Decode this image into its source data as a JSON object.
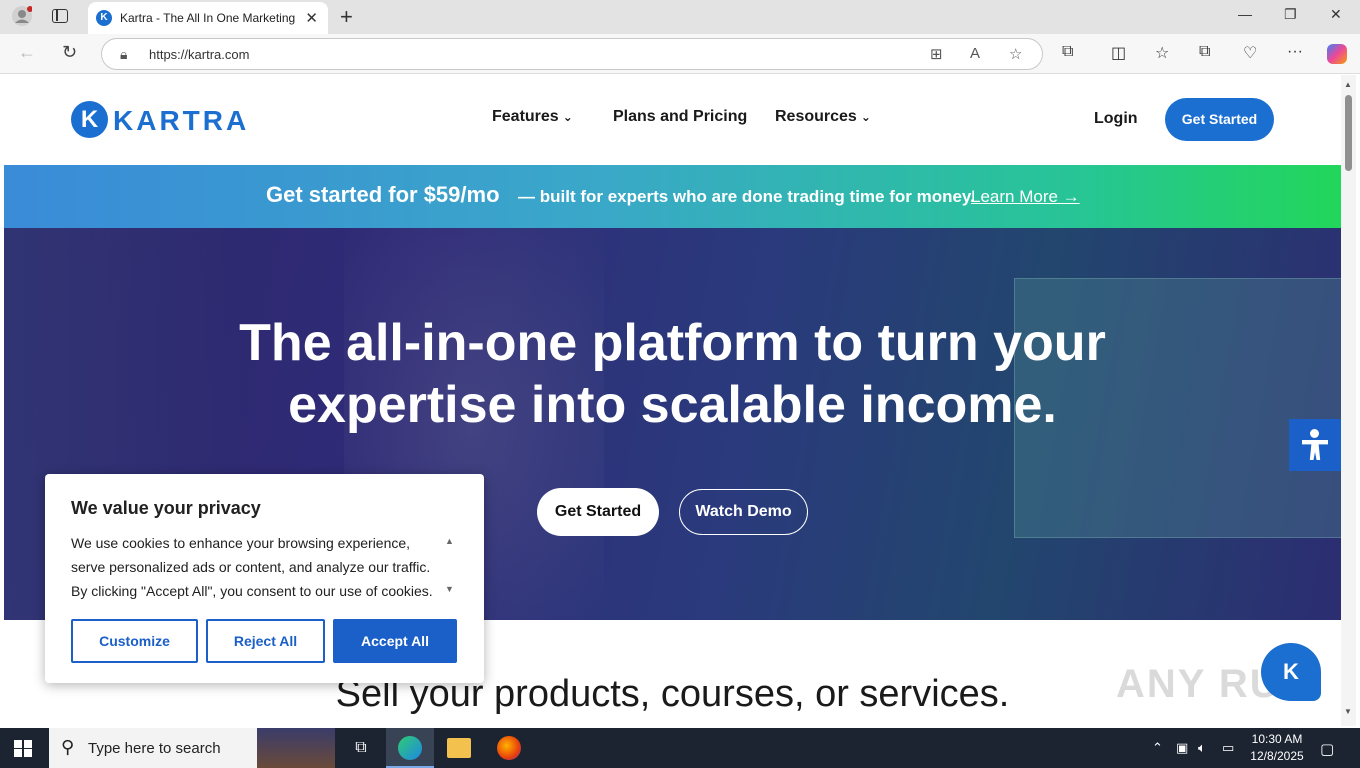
{
  "browser": {
    "tab_title": "Kartra - The All In One Marketing",
    "tab_favicon_letter": "K",
    "url": "https://kartra.com",
    "new_tab_symbol": "+",
    "close_symbol": "✕",
    "minimize_symbol": "—",
    "restore_symbol": "❐",
    "window_close_symbol": "✕"
  },
  "site": {
    "logo_mark": "K",
    "logo_text": "KARTRA",
    "nav": [
      {
        "label": "Features",
        "has_dropdown": true
      },
      {
        "label": "Plans and Pricing",
        "has_dropdown": false
      },
      {
        "label": "Resources",
        "has_dropdown": true
      }
    ],
    "chevron": "⌄",
    "login_label": "Login",
    "header_cta_label": "Get Started"
  },
  "promo": {
    "main": "Get started for $59/mo",
    "sub": "— built for experts who are done trading time for money.",
    "link": "Learn More →"
  },
  "hero": {
    "title_line1": "The all-in-one platform to turn your",
    "title_line2": "expertise into scalable income.",
    "primary_button": "Get Started",
    "secondary_button": "Watch Demo"
  },
  "section": {
    "title": "Sell your products, courses, or services."
  },
  "chat_widget_letter": "K",
  "watermark": "ANY RUN",
  "cookie": {
    "title": "We value your privacy",
    "body": "We use cookies to enhance your browsing experience, serve personalized ads or content, and analyze our traffic. By clicking \"Accept All\", you consent to our use of cookies.",
    "customize": "Customize",
    "reject": "Reject All",
    "accept": "Accept All"
  },
  "taskbar": {
    "search_placeholder": "Type here to search",
    "time": "10:30 AM",
    "date": "12/8/2025"
  },
  "colors": {
    "brand": "#1b6fd0",
    "cookie_button": "#1b5fc8",
    "taskbar": "#1c2431"
  }
}
